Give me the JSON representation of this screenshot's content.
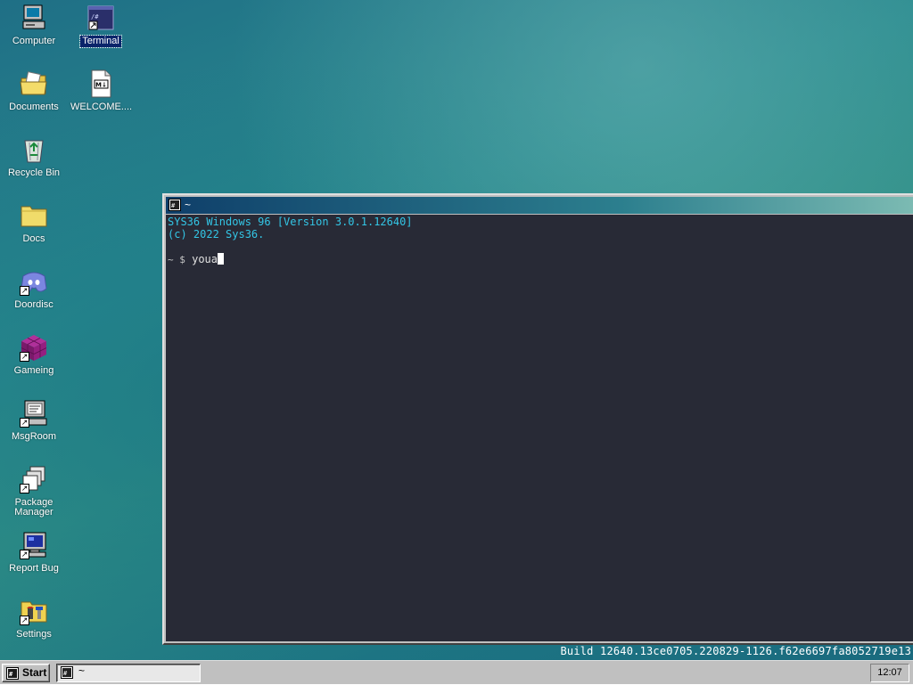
{
  "desktop": {
    "icons": [
      {
        "label": "Computer",
        "icon": "computer-icon"
      },
      {
        "label": "Terminal",
        "icon": "terminal-icon"
      },
      {
        "label": "Documents",
        "icon": "documents-folder-icon"
      },
      {
        "label": "WELCOME....",
        "icon": "markdown-file-icon"
      },
      {
        "label": "Recycle Bin",
        "icon": "recycle-bin-icon"
      },
      {
        "label": "Docs",
        "icon": "folder-icon"
      },
      {
        "label": "Doordisc",
        "icon": "discord-icon"
      },
      {
        "label": "Gameing",
        "icon": "game-cube-icon"
      },
      {
        "label": "MsgRoom",
        "icon": "chat-computer-icon"
      },
      {
        "label": "Package Manager",
        "icon": "package-manager-icon"
      },
      {
        "label": "Report Bug",
        "icon": "report-bug-monitor-icon"
      },
      {
        "label": "Settings",
        "icon": "settings-folder-icon"
      }
    ]
  },
  "terminal": {
    "title": "~",
    "lines": [
      "SYS36 Windows 96 [Version 3.0.1.12640]",
      "(c) 2022 Sys36."
    ],
    "prompt": "~ $",
    "input": "youa"
  },
  "build_info": "Build 12640.13ce0705.220829-1126.f62e6697fa8052719e13",
  "taskbar": {
    "start_label": "Start",
    "tasks": [
      {
        "label": "~"
      }
    ],
    "clock": "12:07"
  },
  "colors": {
    "terminal_background": "#282a36",
    "terminal_banner_text": "#33c6e6",
    "selection": "#0a246a",
    "taskbar": "#c0c0c0"
  }
}
